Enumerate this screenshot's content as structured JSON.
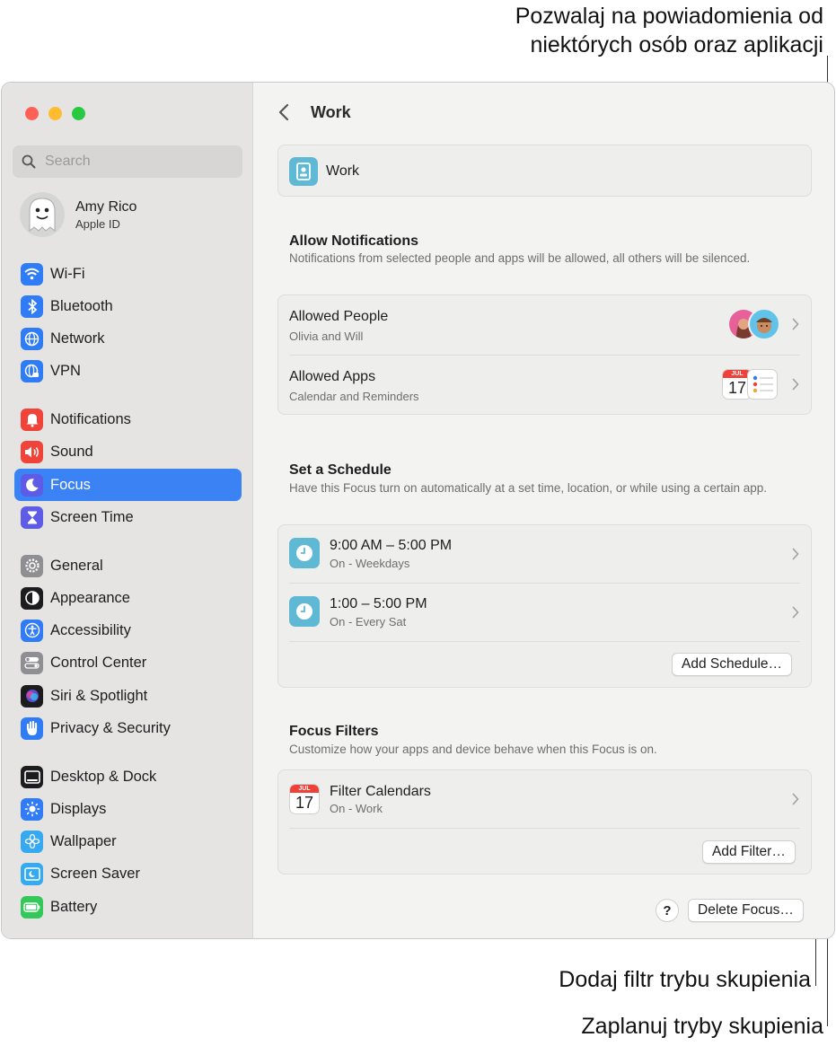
{
  "callouts": {
    "top_line1": "Pozwalaj na powiadomienia od",
    "top_line2": "niektórych osób oraz aplikacji",
    "add_filter": "Dodaj filtr trybu skupienia",
    "schedule": "Zaplanuj tryby skupienia"
  },
  "sidebar": {
    "search_placeholder": "Search",
    "profile": {
      "name": "Amy Rico",
      "subtitle": "Apple ID"
    },
    "items": [
      {
        "label": "Wi-Fi",
        "icon": "wifi-icon",
        "color": "#2f7cf6"
      },
      {
        "label": "Bluetooth",
        "icon": "bluetooth-icon",
        "color": "#2f7cf6"
      },
      {
        "label": "Network",
        "icon": "globe-icon",
        "color": "#2f7cf6"
      },
      {
        "label": "VPN",
        "icon": "vpn-globe-icon",
        "color": "#2f7cf6"
      },
      {
        "label": "Notifications",
        "icon": "bell-icon",
        "color": "#f0433a"
      },
      {
        "label": "Sound",
        "icon": "speaker-icon",
        "color": "#f0433a"
      },
      {
        "label": "Focus",
        "icon": "moon-icon",
        "color": "#5e5ce6"
      },
      {
        "label": "Screen Time",
        "icon": "hourglass-icon",
        "color": "#5e5ce6"
      },
      {
        "label": "General",
        "icon": "gear-icon",
        "color": "#8e8e93"
      },
      {
        "label": "Appearance",
        "icon": "appearance-icon",
        "color": "#1c1c1e"
      },
      {
        "label": "Accessibility",
        "icon": "accessibility-icon",
        "color": "#2f7cf6"
      },
      {
        "label": "Control Center",
        "icon": "switches-icon",
        "color": "#8e8e93"
      },
      {
        "label": "Siri & Spotlight",
        "icon": "siri-icon",
        "color": "#1c1c1e"
      },
      {
        "label": "Privacy & Security",
        "icon": "hand-icon",
        "color": "#2f7cf6"
      },
      {
        "label": "Desktop & Dock",
        "icon": "dock-icon",
        "color": "#1c1c1e"
      },
      {
        "label": "Displays",
        "icon": "sun-icon",
        "color": "#2f7cf6"
      },
      {
        "label": "Wallpaper",
        "icon": "flower-icon",
        "color": "#35aaf0"
      },
      {
        "label": "Screen Saver",
        "icon": "screensaver-icon",
        "color": "#35aaf0"
      },
      {
        "label": "Battery",
        "icon": "battery-icon",
        "color": "#34c759"
      }
    ],
    "active_item": "Focus",
    "accent_color": "#3b82f5"
  },
  "main": {
    "title": "Work",
    "focus_name": "Work",
    "allow": {
      "title": "Allow Notifications",
      "description": "Notifications from selected people and apps will be allowed, all others will be silenced.",
      "people_title": "Allowed People",
      "people_sub": "Olivia and Will",
      "apps_title": "Allowed Apps",
      "apps_sub": "Calendar and Reminders",
      "cal_month": "JUL",
      "cal_day": "17"
    },
    "schedule": {
      "title": "Set a Schedule",
      "description": "Have this Focus turn on automatically at a set time, location, or while using a certain app.",
      "items": [
        {
          "time": "9:00 AM – 5:00 PM",
          "sub": "On - Weekdays"
        },
        {
          "time": "1:00 – 5:00 PM",
          "sub": "On - Every Sat"
        }
      ],
      "add_button": "Add Schedule…"
    },
    "filters": {
      "title": "Focus Filters",
      "description": "Customize how your apps and device behave when this Focus is on.",
      "item_title": "Filter Calendars",
      "item_sub": "On - Work",
      "cal_month": "JUL",
      "cal_day": "17",
      "add_button": "Add Filter…"
    },
    "help_button": "?",
    "delete_button": "Delete Focus…"
  }
}
